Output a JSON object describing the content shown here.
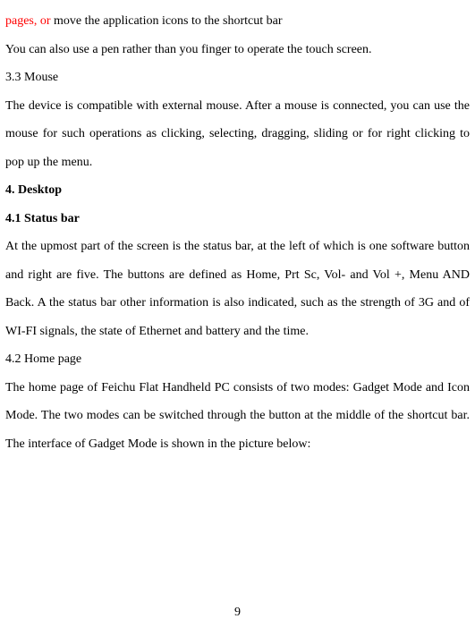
{
  "line1_red": "pages, or ",
  "line1_rest": "move the application icons to the shortcut bar",
  "line2": "You can also use a pen rather than you finger to operate the touch screen.",
  "h33": "3.3 Mouse",
  "p33": "The device is compatible with external mouse. After a mouse is connected, you can use the mouse for such operations as clicking, selecting, dragging, sliding or for right clicking to pop up the menu.",
  "h4": "4. Desktop",
  "h41": "4.1 Status bar",
  "p41": "At the upmost part of the screen is the status bar, at the left of which is one software button and right are five. The buttons are defined as Home, Prt Sc, Vol- and Vol +, Menu AND Back. A the status bar other information is also indicated, such as the strength of 3G and of WI-FI signals, the state of Ethernet and battery and the time.",
  "h42": "4.2 Home page",
  "p42": "The home page of Feichu Flat Handheld PC consists of two modes: Gadget Mode and Icon Mode. The two modes can be switched through the button at the middle of the shortcut bar. The interface of Gadget Mode is shown in the picture below:",
  "page_number": "9"
}
